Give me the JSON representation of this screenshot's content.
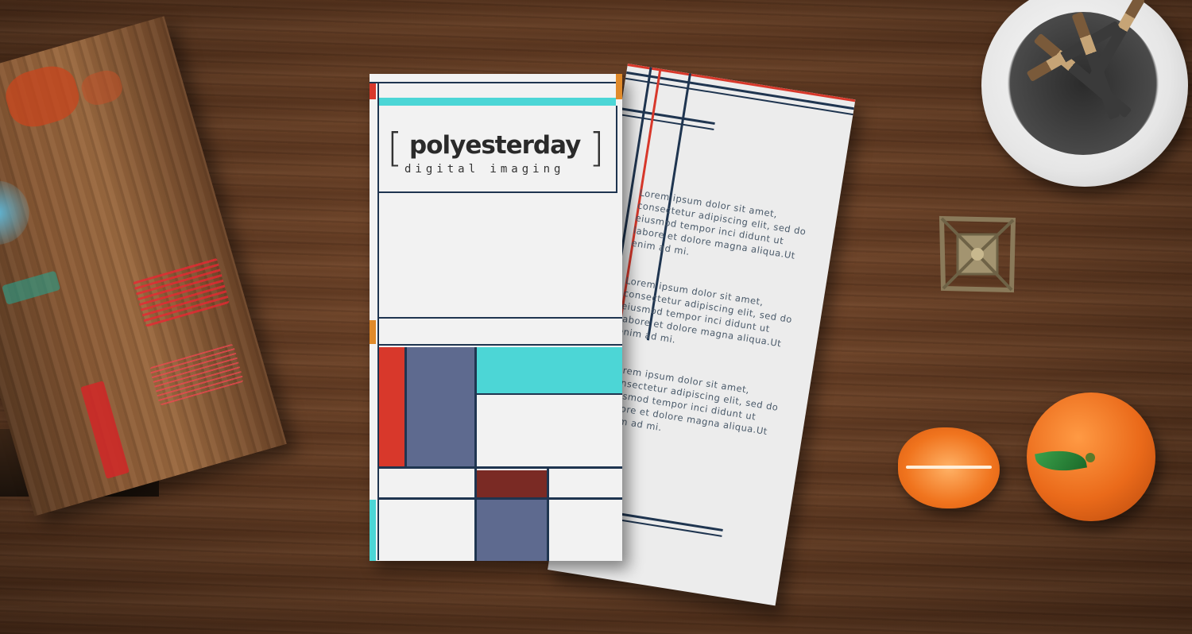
{
  "scene": {
    "colors": {
      "wood": "#5e3820",
      "paper": "#f2f2f2",
      "navy": "#1f3550",
      "red": "#d8382b",
      "teal": "#4cd6d6",
      "slate_blue": "#5e6a8f",
      "maroon": "#7a2a24",
      "orange": "#e86a1e"
    },
    "icons": [
      "pencil-cup-icon",
      "eiffel-tower-figurine-icon",
      "orange-fruit-icon",
      "wood-block-icon"
    ]
  },
  "brochure_front": {
    "logo_name": "polyesterday",
    "logo_subtitle": "digital imaging",
    "bracket_left": "[",
    "bracket_right": "]"
  },
  "brochure_back": {
    "paragraphs": [
      "Lorem ipsum dolor sit amet, consectetur adipiscing elit, sed do eiusmod tempor inci didunt ut labore et dolore magna aliqua.Ut enim ad mi.",
      "Lorem ipsum dolor sit amet, consectetur adipiscing elit, sed do eiusmod tempor inci didunt ut labore et dolore magna aliqua.Ut enim ad mi.",
      "Lorem ipsum dolor sit amet, consectetur adipiscing elit, sed do eiusmod tempor inci didunt ut labore et dolore magna aliqua.Ut enim ad mi."
    ]
  }
}
